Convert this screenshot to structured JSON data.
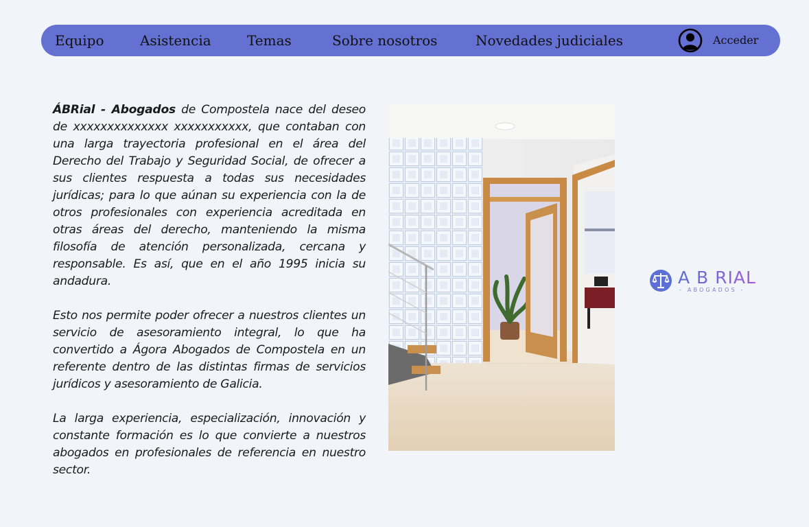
{
  "nav": {
    "items": [
      {
        "label": "Equipo"
      },
      {
        "label": "Asistencia"
      },
      {
        "label": "Temas"
      },
      {
        "label": "Sobre nosotros"
      },
      {
        "label": "Novedades judiciales"
      }
    ],
    "login_label": "Acceder",
    "user_icon": "user-circle-icon"
  },
  "main": {
    "p1_brand": "ÁBRial - Abogados",
    "p1_text": " de Compostela nace del deseo de xxxxxxxxxxxxxx xxxxxxxxxxx, que contaban con una larga trayectoria profesional en el área del Derecho del Trabajo y Seguridad Social, de ofrecer a sus clientes respuesta a todas sus necesidades jurídicas; para lo que aúnan su experiencia con la de otros profesionales con experiencia acreditada en otras áreas del derecho, manteniendo la misma filosofía de atención personalizada, cercana y responsable. Es así, que en el año 1995 inicia su andadura.",
    "p2": "Esto nos permite poder ofrecer a nuestros clientes un servicio de asesoramiento integral, lo que ha convertido a Ágora Abogados de Compostela en un referente dentro de las distintas firmas de servicios jurídicos y asesoramiento de Galicia.",
    "p3": "La larga experiencia, especialización, innovación y constante formación es lo que convierte a nuestros abogados en profesionales de referencia en nuestro sector."
  },
  "logo": {
    "wordmark": "A B RIAL",
    "tagline": "- ABOGADOS -",
    "icon": "scales-of-justice-icon"
  },
  "colors": {
    "page_bg": "#f1f5f9",
    "nav_bg": "#6470d2",
    "logo_gradient_start": "#5b6fd6",
    "logo_gradient_end": "#a15ed3"
  }
}
